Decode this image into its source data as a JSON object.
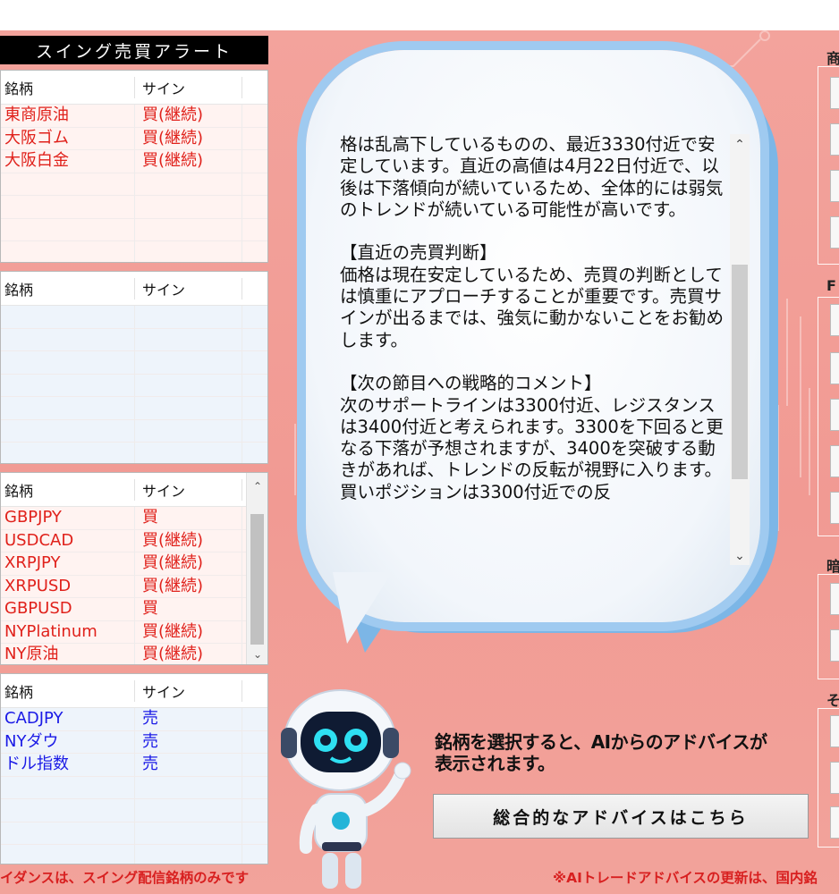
{
  "title": "スイング売買アラート",
  "columns": {
    "symbol": "銘柄",
    "sign": "サイン"
  },
  "panels": [
    {
      "rows": [
        {
          "symbol": "東商原油",
          "sign": "買(継続)"
        },
        {
          "symbol": "大阪ゴム",
          "sign": "買(継続)"
        },
        {
          "symbol": "大阪白金",
          "sign": "買(継続)"
        }
      ]
    },
    {
      "rows": []
    },
    {
      "rows": [
        {
          "symbol": "GBPJPY",
          "sign": "買"
        },
        {
          "symbol": "USDCAD",
          "sign": "買(継続)"
        },
        {
          "symbol": "XRPJPY",
          "sign": "買(継続)"
        },
        {
          "symbol": "XRPUSD",
          "sign": "買(継続)"
        },
        {
          "symbol": "GBPUSD",
          "sign": "買"
        },
        {
          "symbol": "NYPlatinum",
          "sign": "買(継続)"
        },
        {
          "symbol": "NY原油",
          "sign": "買(継続)"
        }
      ]
    },
    {
      "rows": [
        {
          "symbol": "CADJPY",
          "sign": "売"
        },
        {
          "symbol": "NYダウ",
          "sign": "売"
        },
        {
          "symbol": "ドル指数",
          "sign": "売"
        }
      ]
    }
  ],
  "advice_text": "格は乱高下しているものの、最近3330付近で安定しています。直近の高値は4月22日付近で、以後は下落傾向が続いているため、全体的には弱気のトレンドが続いている可能性が高いです。\n\n【直近の売買判断】\n価格は現在安定しているため、売買の判断としては慎重にアプローチすることが重要です。売買サインが出るまでは、強気に動かないことをお勧めします。\n\n【次の節目への戦略的コメント】\n次のサポートラインは3300付近、レジスタンスは3400付近と考えられます。3300を下回ると更なる下落が予想されますが、3400を突破する動きがあれば、トレンドの反転が視野に入ります。買いポジションは3300付近での反",
  "hint": {
    "line1": "銘柄を選択すると、AIからのアドバイスが",
    "line2": "表示されます。"
  },
  "advice_button": "総合的なアドバイスはこちら",
  "footer_left": "イダンスは、スイング配信銘柄のみです",
  "footer_right": "※AIトレードアドバイスの更新は、国内銘",
  "right_labels": [
    "商",
    "F",
    "暗",
    "そ"
  ],
  "colors": {
    "buy": "#e0211b",
    "sell": "#1a1ae6",
    "background": "#f19a93",
    "bubble_border": "#9fcaf0"
  }
}
